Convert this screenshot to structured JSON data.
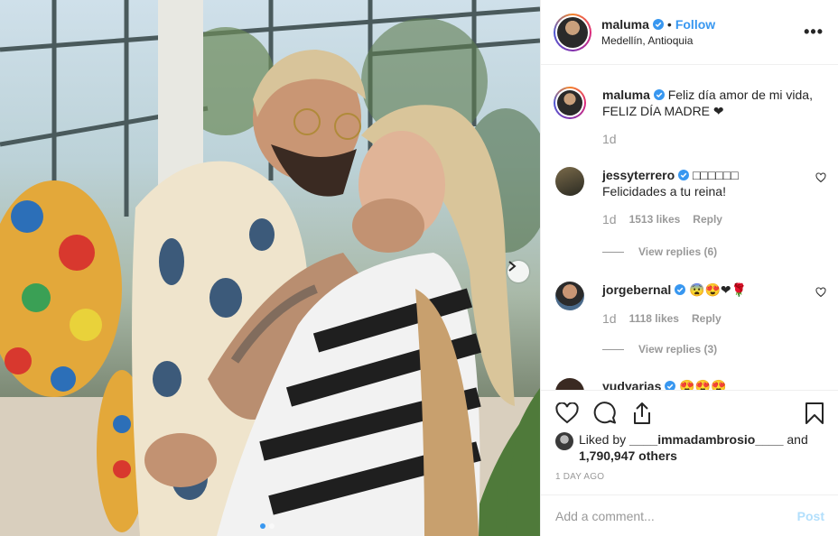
{
  "post": {
    "username": "maluma",
    "follow_label": "Follow",
    "separator": "•",
    "location": "Medellín, Antioquia",
    "more_icon": "more-options-icon"
  },
  "caption": {
    "username": "maluma",
    "text": "Feliz día amor de mi vida,",
    "text_line2": "FELIZ DÍA MADRE ❤",
    "time": "1d"
  },
  "comments": [
    {
      "username": "jessyterrero",
      "badge": "□□□□□□",
      "text": "Felicidades a tu reina!",
      "time": "1d",
      "likes": "1513 likes",
      "reply": "Reply",
      "view_replies": "View replies (6)"
    },
    {
      "username": "jorgebernal",
      "badge": "😨😍❤🌹",
      "text": "",
      "time": "1d",
      "likes": "1118 likes",
      "reply": "Reply",
      "view_replies": "View replies (3)"
    },
    {
      "username": "yudyarias",
      "badge": "😍😍😍",
      "text": ""
    }
  ],
  "likes_section": {
    "prefix": "Liked by",
    "user": "____immadambrosio____",
    "and": "and",
    "others": "1,790,947 others"
  },
  "time_ago": "1 DAY AGO",
  "add_comment": {
    "placeholder": "Add a comment...",
    "post_label": "Post"
  },
  "colors": {
    "accent": "#3897f0",
    "verified": "#3897f0",
    "muted": "#999999",
    "post_disabled": "#b2dffc"
  }
}
